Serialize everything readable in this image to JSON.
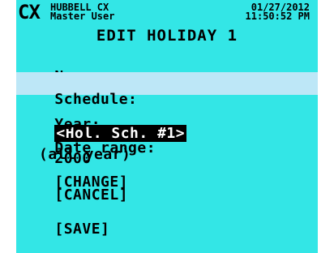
{
  "header": {
    "logo": "CX",
    "brand": "HUBBELL CX",
    "user": "Master User",
    "date": "01/27/2012",
    "time": "11:50:52 PM"
  },
  "title": "EDIT HOLIDAY 1",
  "fields": {
    "name_label": "Name:",
    "schedule_label": "Schedule:",
    "schedule_value": "<Hol. Sch. #1>",
    "year_label": "Year:",
    "year_value": "2000",
    "date_range_label": "Date range:",
    "date_range_button": "[CHANGE]",
    "date_range_value": "(all year)"
  },
  "actions": {
    "cancel": "[CANCEL]",
    "save": "[SAVE]"
  }
}
